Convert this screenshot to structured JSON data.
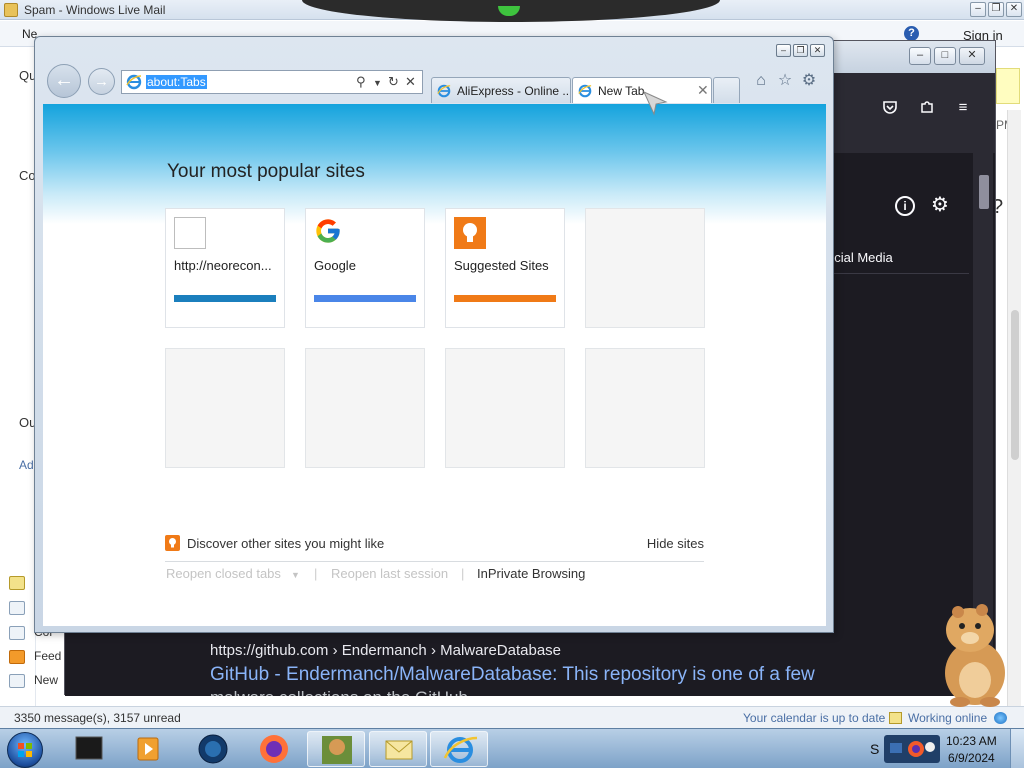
{
  "wlm": {
    "title": "Spam - Windows Live Mail",
    "menu_cut": "Ne",
    "sign_in": "Sign in",
    "sidebar_letters": [
      "Qu",
      "Co",
      "Ou",
      "Ad"
    ],
    "sidebar_items": [
      "Cor",
      "Feed",
      "New"
    ],
    "status_left": "3350 message(s), 3157 unread",
    "status_calendar": "Your calendar is up to date",
    "status_online": "Working online",
    "pm": "PM",
    "right_q": "?"
  },
  "firefox": {
    "social_media": "ocial Media",
    "result_url": "https://github.com › Endermanch › MalwareDatabase",
    "result_title": "GitHub - Endermanch/MalwareDatabase: This repository is one of a few",
    "result_snippet": "malware collections on the GitHub"
  },
  "ie": {
    "address": "about:Tabs",
    "tabs": [
      {
        "label": "AliExpress - Online ..."
      },
      {
        "label": "New Tab"
      }
    ],
    "heading": "Your most popular sites",
    "tiles": [
      {
        "label": "http://neorecon...",
        "bar_color": "#1b7fbd"
      },
      {
        "label": "Google",
        "bar_color": "#4a86e8"
      },
      {
        "label": "Suggested Sites",
        "bar_color": "#f07a17"
      }
    ],
    "discover": "Discover other sites you might like",
    "hide_sites": "Hide sites",
    "reopen_closed": "Reopen closed tabs",
    "reopen_last": "Reopen last session",
    "inprivate": "InPrivate Browsing"
  },
  "taskbar": {
    "time": "10:23 AM",
    "date": "6/9/2024",
    "tray_letter": "S"
  },
  "colors": {
    "ie_gradient_top": "#14a3dd",
    "link_blue": "#8ab4f8",
    "firefox_bg": "#1c1b22"
  }
}
